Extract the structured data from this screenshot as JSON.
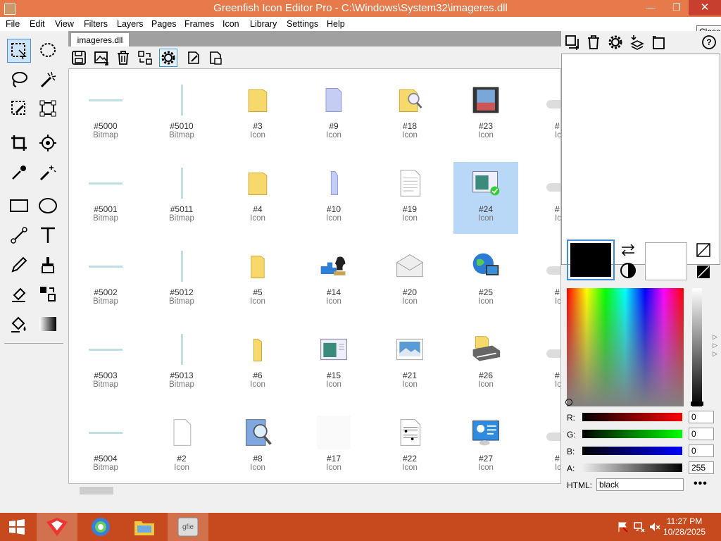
{
  "window": {
    "title": "Greenfish Icon Editor Pro - C:\\Windows\\System32\\imageres.dll",
    "close_tooltip": "Close"
  },
  "menu": [
    "File",
    "Edit",
    "View",
    "Filters",
    "Layers",
    "Pages",
    "Frames",
    "Icon",
    "Library",
    "Settings",
    "Help"
  ],
  "tab": {
    "label": "imageres.dll"
  },
  "grid_items": [
    {
      "id": "#5000",
      "kind": "Bitmap",
      "icon": "h-line"
    },
    {
      "id": "#5010",
      "kind": "Bitmap",
      "icon": "v-line"
    },
    {
      "id": "#3",
      "kind": "Icon",
      "icon": "folder"
    },
    {
      "id": "#9",
      "kind": "Icon",
      "icon": "blue-folder"
    },
    {
      "id": "#18",
      "kind": "Icon",
      "icon": "folder-search"
    },
    {
      "id": "#23",
      "kind": "Icon",
      "icon": "film"
    },
    {
      "id": "#5001",
      "kind": "Bitmap",
      "icon": "h-line"
    },
    {
      "id": "#5011",
      "kind": "Bitmap",
      "icon": "v-line"
    },
    {
      "id": "#4",
      "kind": "Icon",
      "icon": "folder"
    },
    {
      "id": "#10",
      "kind": "Icon",
      "icon": "blue-folder-narrow"
    },
    {
      "id": "#19",
      "kind": "Icon",
      "icon": "document"
    },
    {
      "id": "#24",
      "kind": "Icon",
      "icon": "window-check"
    },
    {
      "id": "#5002",
      "kind": "Bitmap",
      "icon": "h-line"
    },
    {
      "id": "#5012",
      "kind": "Bitmap",
      "icon": "v-line"
    },
    {
      "id": "#5",
      "kind": "Icon",
      "icon": "folder-narrow"
    },
    {
      "id": "#14",
      "kind": "Icon",
      "icon": "puzzle-chess"
    },
    {
      "id": "#20",
      "kind": "Icon",
      "icon": "envelope"
    },
    {
      "id": "#25",
      "kind": "Icon",
      "icon": "globe-monitor"
    },
    {
      "id": "#5003",
      "kind": "Bitmap",
      "icon": "h-line"
    },
    {
      "id": "#5013",
      "kind": "Bitmap",
      "icon": "v-line"
    },
    {
      "id": "#6",
      "kind": "Icon",
      "icon": "folder-thin"
    },
    {
      "id": "#15",
      "kind": "Icon",
      "icon": "window"
    },
    {
      "id": "#21",
      "kind": "Icon",
      "icon": "picture"
    },
    {
      "id": "#26",
      "kind": "Icon",
      "icon": "printer"
    },
    {
      "id": "#5004",
      "kind": "Bitmap",
      "icon": "h-line"
    },
    {
      "id": "#2",
      "kind": "Icon",
      "icon": "blank-page"
    },
    {
      "id": "#8",
      "kind": "Icon",
      "icon": "search-doc"
    },
    {
      "id": "#17",
      "kind": "Icon",
      "icon": "empty"
    },
    {
      "id": "#22",
      "kind": "Icon",
      "icon": "music-doc"
    },
    {
      "id": "#27",
      "kind": "Icon",
      "icon": "control-panel"
    }
  ],
  "partial_column": [
    "#",
    "#",
    "#",
    "#",
    "#"
  ],
  "partial_column_kind": [
    "Ic",
    "Ic",
    "Ic",
    "Ic",
    "Ic"
  ],
  "selected_item": "#24",
  "color": {
    "primary": "#000000",
    "secondary": "#ffffff",
    "r_label": "R:",
    "g_label": "G:",
    "b_label": "B:",
    "a_label": "A:",
    "r": "0",
    "g": "0",
    "b": "0",
    "a": "255",
    "html_label": "HTML:",
    "html_value": "black"
  },
  "taskbar": {
    "time": "11:27 PM",
    "date": "10/28/2025",
    "color": "#c74a1e"
  }
}
